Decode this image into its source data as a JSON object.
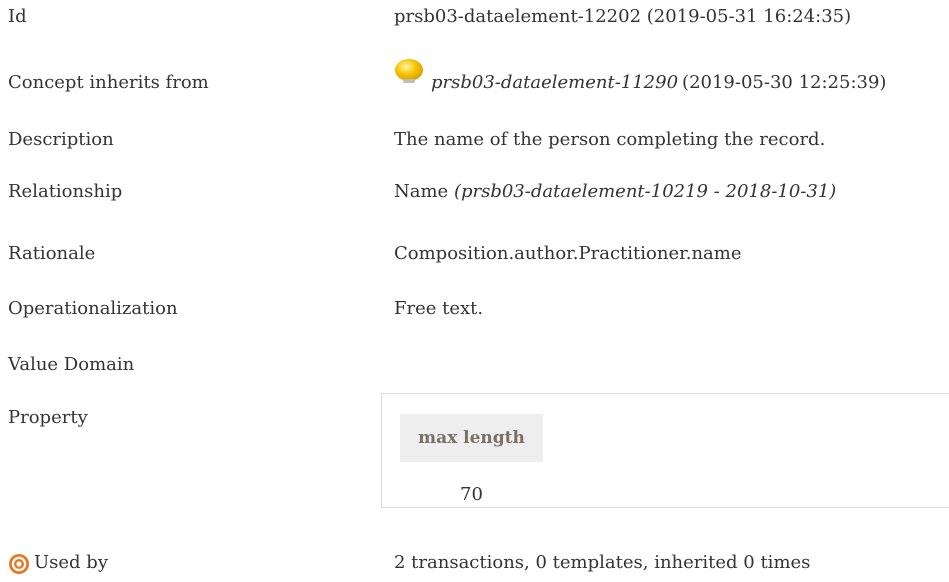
{
  "rows": {
    "id": {
      "label": "Id",
      "value": "prsb03-dataelement-12202 (2019-05-31 16:24:35)"
    },
    "inherits": {
      "label": "Concept inherits from",
      "link": "prsb03-dataelement-11290",
      "date": "(2019-05-30 12:25:39)",
      "icon": "lightbulb-icon"
    },
    "description": {
      "label": "Description",
      "value": "The name of the person completing the record."
    },
    "relationship": {
      "label": "Relationship",
      "value": "Name",
      "ref": "(prsb03-dataelement-10219 - 2018-10-31)"
    },
    "rationale": {
      "label": "Rationale",
      "value": "Composition.author.Practitioner.name"
    },
    "operationalization": {
      "label": "Operationalization",
      "value": "Free text."
    },
    "value_domain": {
      "label": "Value Domain"
    },
    "property": {
      "label": "Property",
      "header": "max length",
      "value": "70"
    },
    "used_by": {
      "label": "Used by",
      "value": "2 transactions, 0 templates, inherited 0 times",
      "icon": "target-icon"
    }
  },
  "colors": {
    "text": "#333333",
    "property_header_bg": "#eeeeee",
    "property_header_text": "#7b7066",
    "box_border": "#d9d9d9",
    "bulb": "#f5c400",
    "target": "#e87722"
  }
}
